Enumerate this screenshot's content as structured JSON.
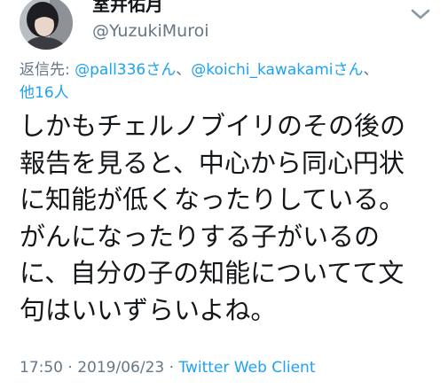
{
  "user": {
    "display_name": "室井佑月",
    "handle": "@YuzukiMuroi"
  },
  "reply": {
    "prefix": "返信先: ",
    "mention_1": "@pall336さん",
    "separator_1": "、",
    "mention_2": "@koichi_kawakamiさん",
    "separator_2": "、",
    "others": "他16人"
  },
  "tweet": {
    "text": "しかもチェルノブイリのその後の\n報告を見ると、中心から同心円状\nに知能が低くなったりしている。\nがんになったりする子がいるの\nに、自分の子の知能についてて文\n句はいいずらいよね。"
  },
  "meta": {
    "time": "17:50",
    "dot_1": " · ",
    "date": "2019/06/23",
    "dot_2": " · ",
    "client": "Twitter Web Client"
  },
  "icons": {
    "avatar": "avatar",
    "menu": "chevron-down-icon"
  },
  "colors": {
    "link": "#1da1f2",
    "secondary": "#657786",
    "text": "#14171a"
  }
}
